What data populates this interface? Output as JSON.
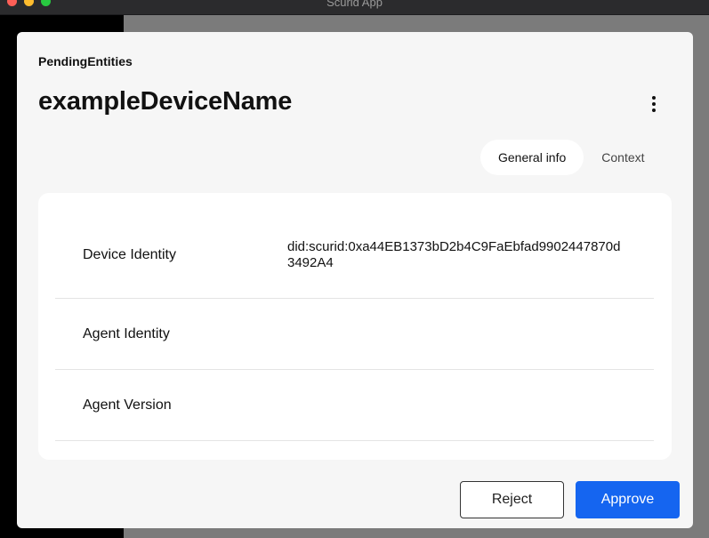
{
  "window": {
    "title": "Scurid App"
  },
  "header": {
    "breadcrumb": "PendingEntities",
    "title": "exampleDeviceName",
    "menu_icon": "kebab-menu-icon"
  },
  "tabs": [
    {
      "label": "General info",
      "active": true
    },
    {
      "label": "Context",
      "active": false
    }
  ],
  "details": [
    {
      "label": "Device Identity",
      "value": "did:scurid:0xa44EB1373bD2b4C9FaEbfad9902447870d3492A4"
    },
    {
      "label": "Agent Identity",
      "value": ""
    },
    {
      "label": "Agent Version",
      "value": ""
    }
  ],
  "actions": {
    "reject_label": "Reject",
    "approve_label": "Approve"
  },
  "colors": {
    "primary": "#1565f0",
    "modal_bg": "#f6f6f6",
    "card_bg": "#ffffff"
  }
}
